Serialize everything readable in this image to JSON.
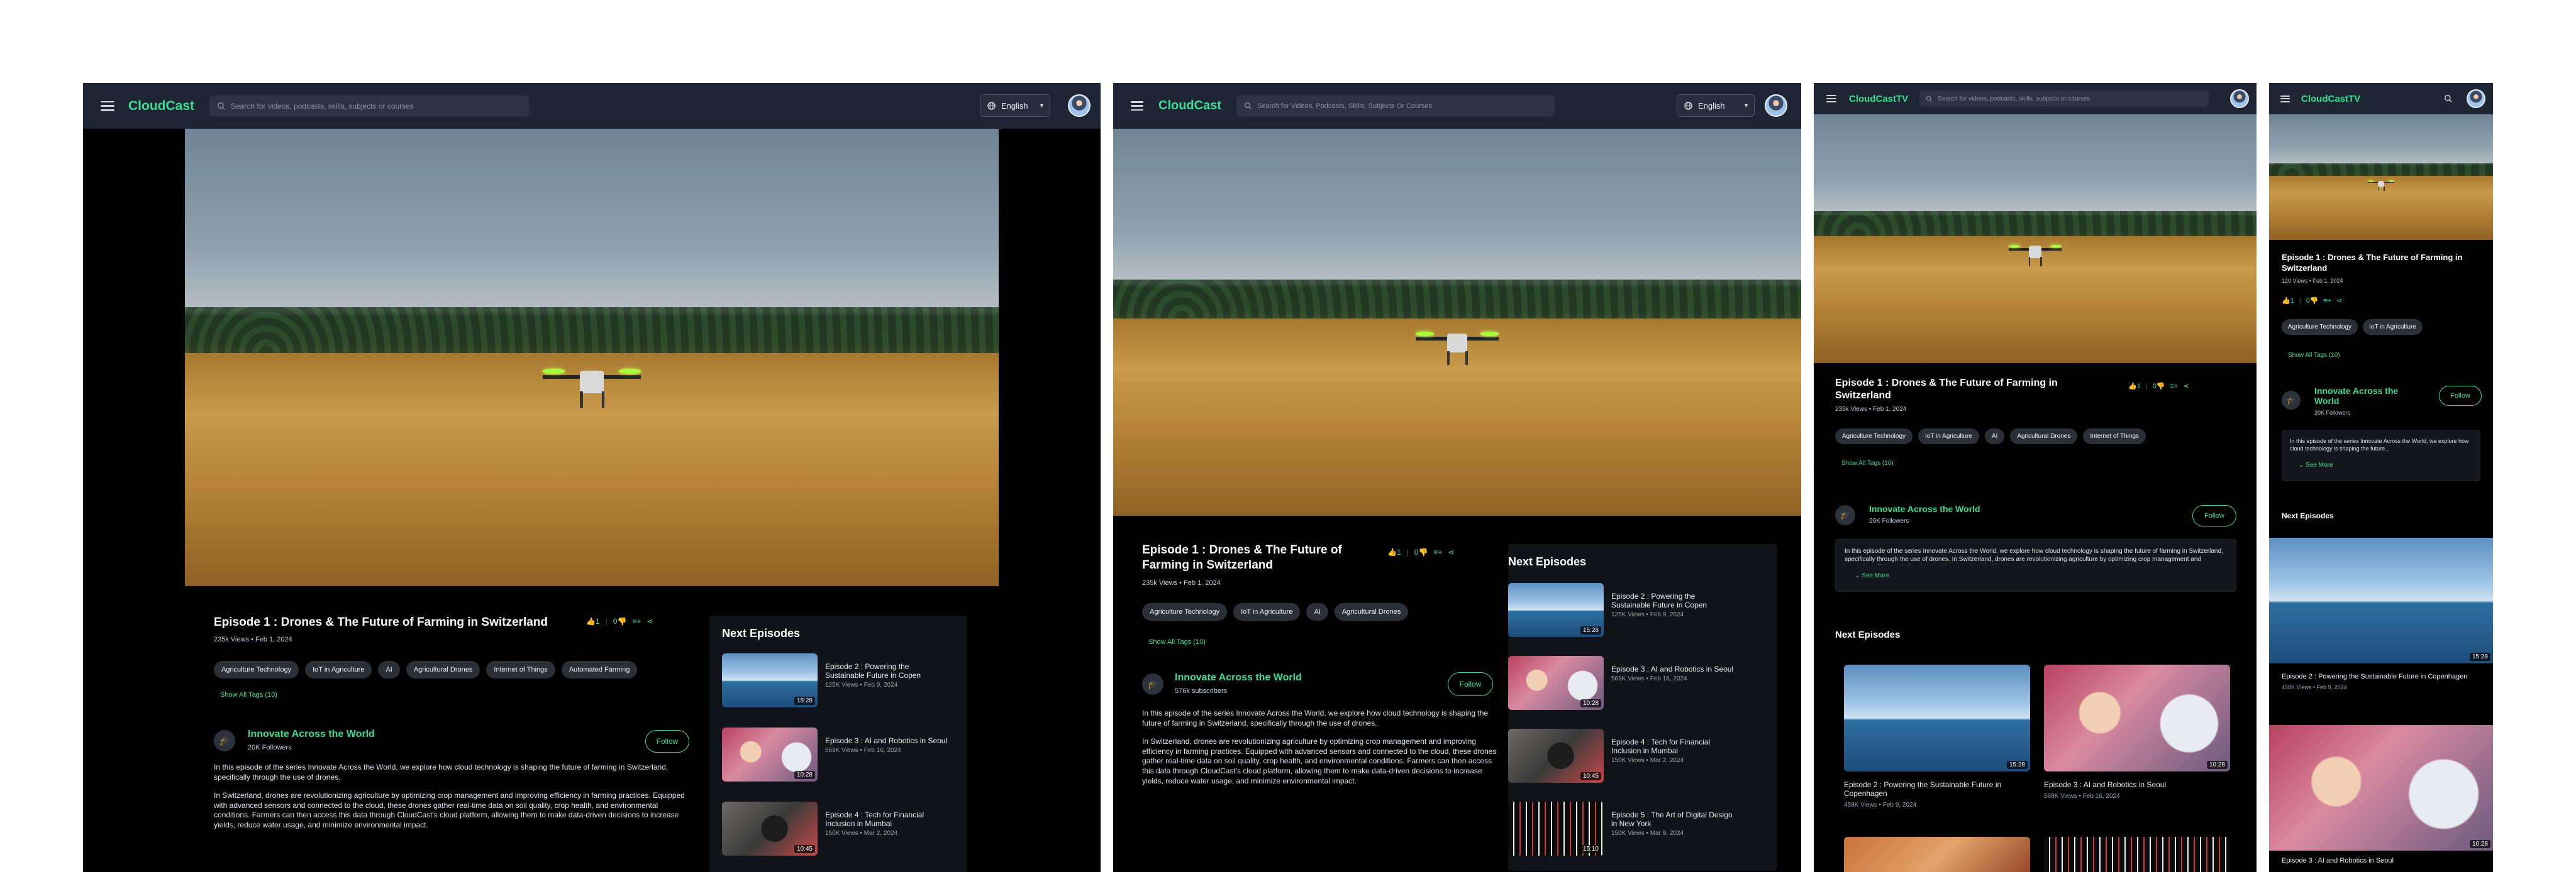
{
  "brand": {
    "accent": "#3ddc97",
    "header_bg": "#1e2533",
    "page_bg": "#000000"
  },
  "screens": {
    "desktop": {
      "logo": "CloudCast",
      "search_placeholder": "Search for videos, podcasts, skills, subjects or courses",
      "language": "English",
      "title": "Episode 1 : Drones & The Future of Farming in Switzerland",
      "views": "235k Views",
      "date": "Feb 1, 2024",
      "likes": "1",
      "dislikes": "0",
      "tags": [
        "Agriculture Technology",
        "IoT in Agriculture",
        "AI",
        "Agricultural Drones",
        "Internet of Things",
        "Automated Farming"
      ],
      "show_all": "Show All Tags (10)",
      "channel": "Innovate Across the World",
      "followers": "20K Followers",
      "follow": "Follow",
      "desc_p1": "In this episode of the series Innovate Across the World, we explore how cloud technology is shaping the future of farming in Switzerland, specifically through the use of drones.",
      "desc_p2": "In Switzerland, drones are revolutionizing agriculture by optimizing crop management and improving efficiency in farming practices. Equipped with advanced sensors and connected to the cloud, these drones gather real-time data on soil quality, crop health, and environmental conditions. Farmers can then access this data through CloudCast's cloud platform, allowing them to make data-driven decisions to increase yields, reduce water usage, and minimize environmental impact.",
      "next_title": "Next Episodes",
      "episodes": [
        {
          "title": "Episode 2 : Powering the Sustainable Future in Copen",
          "views": "125K Views",
          "date": "Feb 9, 2024",
          "duration": "15:28"
        },
        {
          "title": "Episode 3 : AI and Robotics in Seoul",
          "views": "569K Views",
          "date": "Feb 16, 2024",
          "duration": "10:28"
        },
        {
          "title": "Episode 4 : Tech for Financial Inclusion in Mumbai",
          "views": "150K Views",
          "date": "Mar 2, 2024",
          "duration": "10:45"
        }
      ]
    },
    "tablet": {
      "logo": "CloudCast",
      "search_placeholder": "Search for Videos, Podcasts, Skills, Subjects Or Courses",
      "language": "English",
      "title": "Episode 1 : Drones & The Future of Farming in Switzerland",
      "views": "235k Views",
      "date": "Feb 1, 2024",
      "likes": "1",
      "dislikes": "0",
      "tags": [
        "Agriculture Technology",
        "IoT in Agriculture",
        "AI",
        "Agricultural Drones"
      ],
      "show_all": "Show All Tags (10)",
      "channel": "Innovate Across the World",
      "followers": "576k subscribers",
      "follow": "Follow",
      "desc_p1": "In this episode of the series Innovate Across the World, we explore how cloud technology is shaping the future of farming in Switzerland, specifically through the use of drones.",
      "desc_p2": "In Switzerland, drones are revolutionizing agriculture by optimizing crop management and improving efficiency in farming practices. Equipped with advanced sensors and connected to the cloud, these drones gather real-time data on soil quality, crop health, and environmental conditions. Farmers can then access this data through CloudCast's cloud platform, allowing them to make data-driven decisions to increase yields, reduce water usage, and minimize environmental impact.",
      "next_title": "Next Episodes",
      "episodes": [
        {
          "title": "Episode 2 : Powering the Sustainable Future in Copen",
          "views": "125K Views",
          "date": "Feb 9, 2024",
          "duration": "15:28"
        },
        {
          "title": "Episode 3 : AI and Robotics in Seoul",
          "views": "569K Views",
          "date": "Feb 16, 2024",
          "duration": "10:28"
        },
        {
          "title": "Episode 4 : Tech for Financial Inclusion in Mumbai",
          "views": "150K Views",
          "date": "Mar 2, 2024",
          "duration": "10:45"
        },
        {
          "title": "Episode 5 : The Art of Digital Design in New York",
          "views": "150K Views",
          "date": "Mar 9, 2024",
          "duration": "15:10"
        }
      ]
    },
    "small": {
      "logo": "CloudCastTV",
      "search_placeholder": "Search for videos, podcasts, skills, subjects or courses",
      "title": "Episode 1 : Drones & The Future of Farming in Switzerland",
      "views": "235k Views",
      "date": "Feb 1, 2024",
      "likes": "1",
      "dislikes": "0",
      "tags": [
        "Agriculture Technology",
        "IoT in Agriculture",
        "AI",
        "Agricultural Drones",
        "Internet of Things"
      ],
      "show_all": "Show All Tags (10)",
      "channel": "Innovate Across the World",
      "followers": "20K Followers",
      "follow": "Follow",
      "desc_short": "In this episode of the series Innovate Across the World, we explore how cloud technology is shaping the future of farming in Switzerland, specifically through the use of drones. In Switzerland, drones are revolutionizing agriculture by optimizing crop management and improving efficiency in farming practices. Equipped with advanced sensors and connected to the cloud...",
      "see_more": "See More",
      "next_title": "Next Episodes",
      "episodes": [
        {
          "title": "Episode 2 : Powering the Sustainable Future in Copenhagen",
          "views": "458K Views",
          "date": "Feb 9, 2024",
          "duration": "15:28"
        },
        {
          "title": "Episode 3 : AI and Robotics in Seoul",
          "views": "568K Views",
          "date": "Feb 16, 2024",
          "duration": "10:28"
        }
      ]
    },
    "mobile": {
      "logo": "CloudCastTV",
      "title": "Episode 1 : Drones & The Future of Farming in Switzerland",
      "views": "120 Views",
      "date": "Feb 1, 2024",
      "likes": "1",
      "dislikes": "0",
      "tags": [
        "Agriculture Technology",
        "IoT in Agriculture"
      ],
      "show_all": "Show All Tags (10)",
      "channel": "Innovate Across the World",
      "followers": "20K Followers",
      "follow": "Follow",
      "desc_short": "In this episode of the series Innovate Across the World, we explore how cloud technology is shaping the future...",
      "see_more": "See More",
      "next_title": "Next Episodes",
      "episodes": [
        {
          "title": "Episode 2 : Powering the Sustainable Future in Copenhagen",
          "views": "458K Views",
          "date": "Feb 9, 2024",
          "duration": "15:28"
        },
        {
          "title": "Episode 3 : AI and Robotics in Seoul",
          "duration": "10:28"
        }
      ]
    }
  }
}
